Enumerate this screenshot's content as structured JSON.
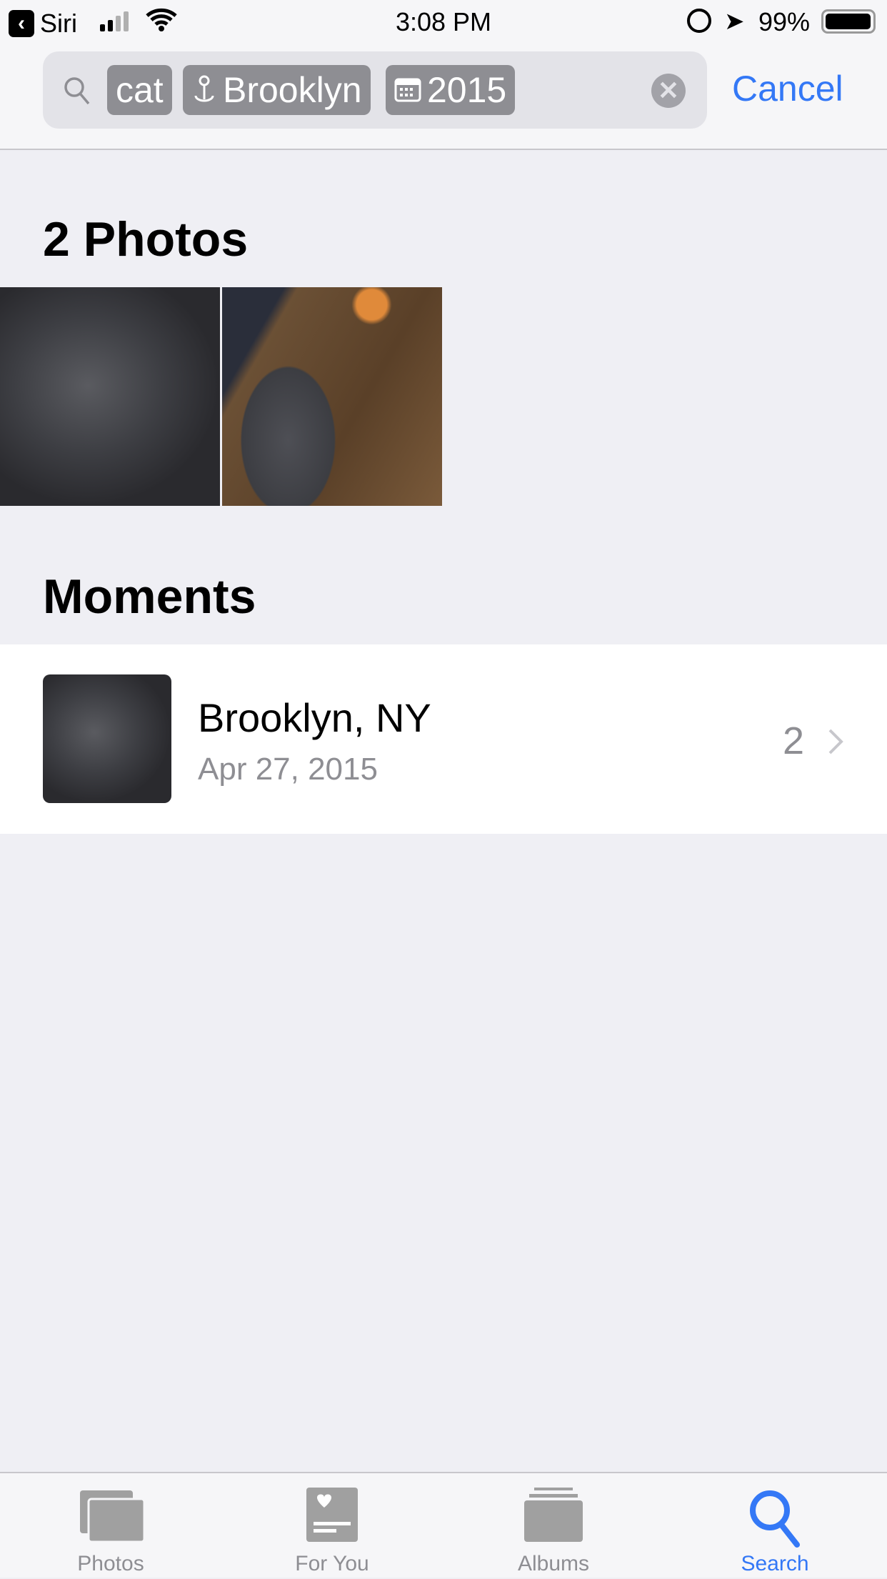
{
  "status_bar": {
    "back_app": "Siri",
    "time": "3:08 PM",
    "battery": "99%",
    "battery_level": 0.99,
    "signal_bars": 2
  },
  "search": {
    "tokens": [
      {
        "label": "cat",
        "icon": "none"
      },
      {
        "label": "Brooklyn",
        "icon": "location-pin-icon"
      },
      {
        "label": "2015",
        "icon": "calendar-icon"
      }
    ],
    "cancel_label": "Cancel"
  },
  "photos_section": {
    "title": "2 Photos"
  },
  "moments_section": {
    "title": "Moments",
    "items": [
      {
        "title": "Brooklyn, NY",
        "date": "Apr 27, 2015",
        "count": "2"
      }
    ]
  },
  "tabs": [
    {
      "label": "Photos",
      "active": false
    },
    {
      "label": "For You",
      "active": false
    },
    {
      "label": "Albums",
      "active": false
    },
    {
      "label": "Search",
      "active": true
    }
  ],
  "colors": {
    "accent": "#3478f6",
    "inactive": "#8e8e93"
  }
}
